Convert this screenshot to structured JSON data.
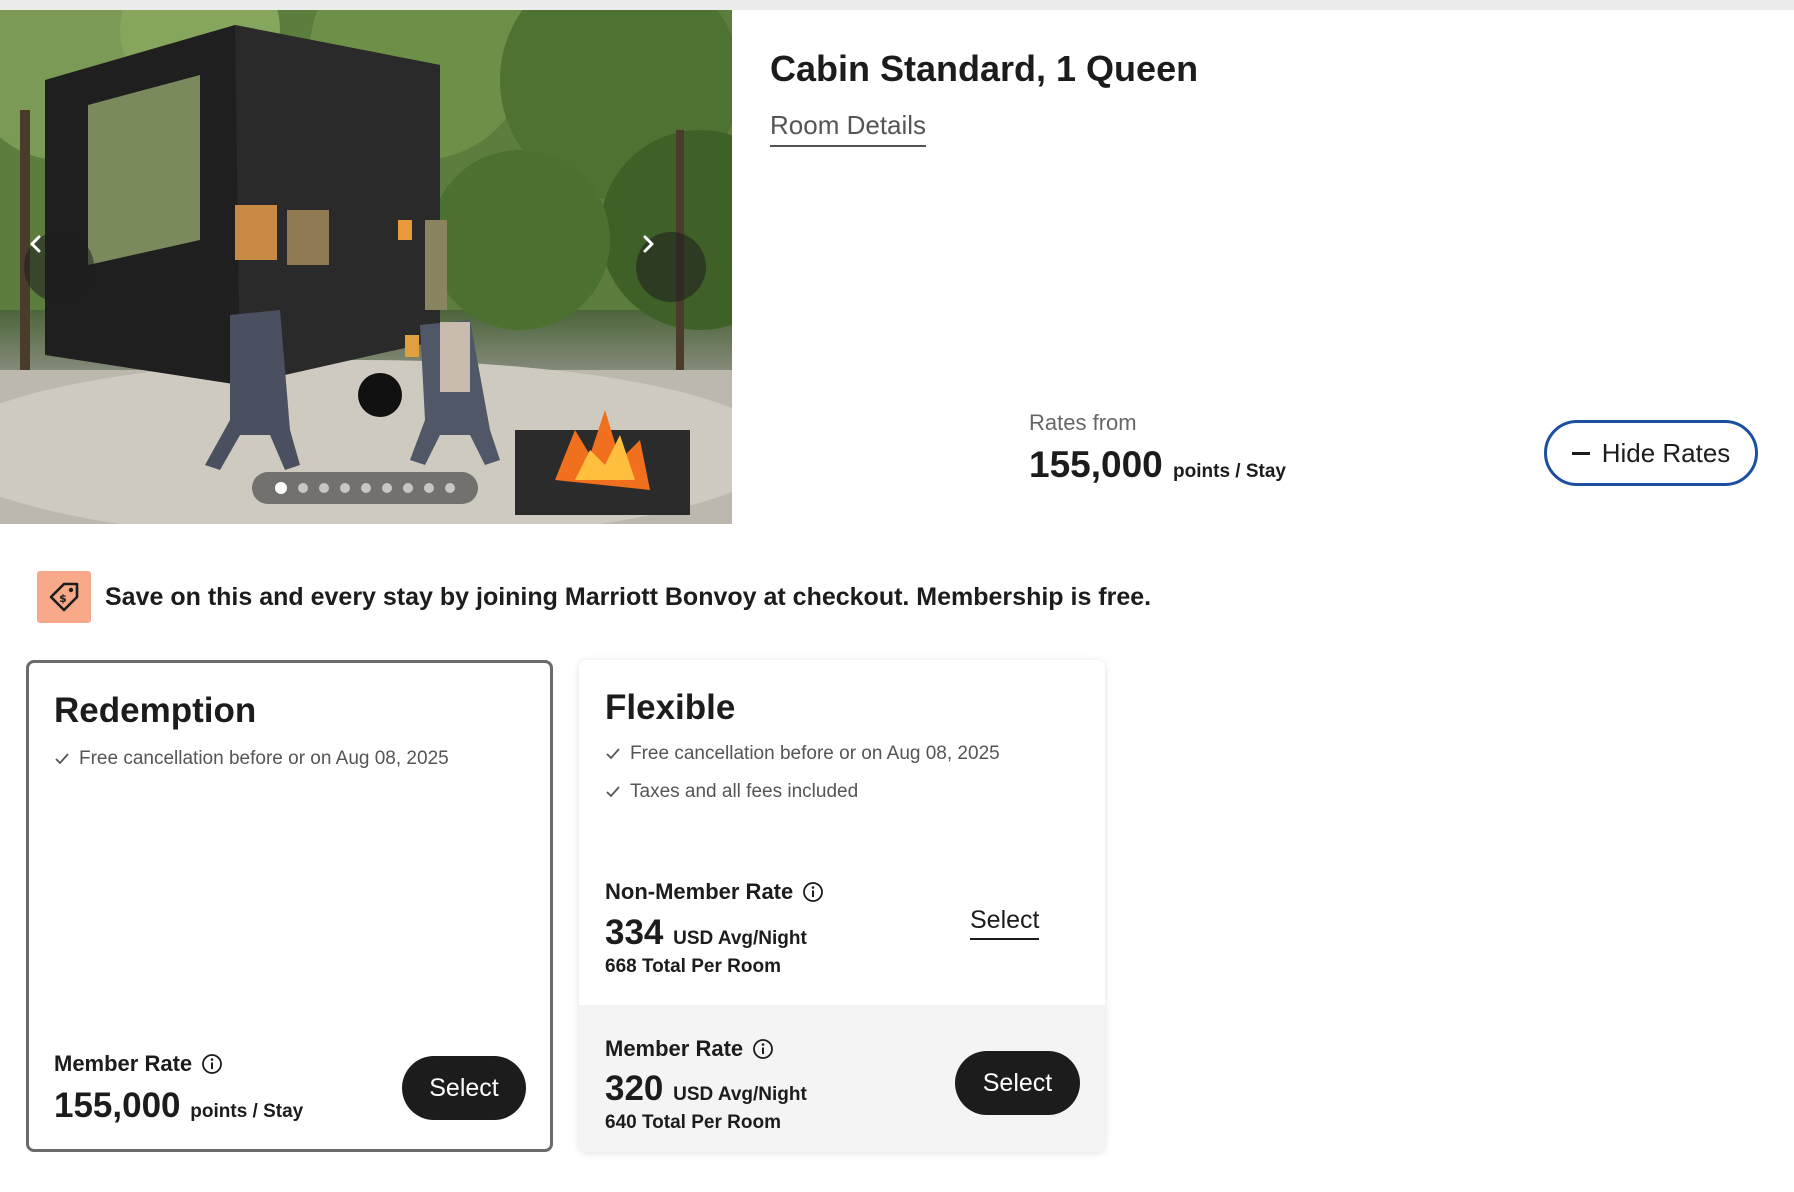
{
  "room": {
    "title": "Cabin Standard, 1 Queen",
    "details_link": "Room Details"
  },
  "gallery": {
    "image_description": "Black tiny cabin in the woods with Adirondack chairs and a fire pit",
    "prev_icon": "chevron-left-icon",
    "next_icon": "chevron-right-icon",
    "slide_count": 9,
    "active_slide": 1
  },
  "rates_summary": {
    "label": "Rates from",
    "amount": "155,000",
    "unit": "points / Stay"
  },
  "hide_rates_button": {
    "label": "Hide Rates",
    "icon": "minus-icon"
  },
  "promo": {
    "icon": "tag-icon",
    "text": "Save on this and every stay by joining Marriott Bonvoy at checkout. Membership is free.",
    "icon_bg": "#f7a98a"
  },
  "cards": {
    "redemption": {
      "title": "Redemption",
      "features": [
        "Free cancellation before or on Aug 08, 2025"
      ],
      "member_rate": {
        "label": "Member Rate",
        "amount": "155,000",
        "unit": "points / Stay",
        "button": "Select"
      }
    },
    "flexible": {
      "title": "Flexible",
      "features": [
        "Free cancellation before or on Aug 08, 2025",
        "Taxes and all fees included"
      ],
      "non_member_rate": {
        "label": "Non-Member Rate",
        "amount": "334",
        "unit": "USD Avg/Night",
        "total": "668 Total Per Room",
        "button": "Select"
      },
      "member_rate": {
        "label": "Member Rate",
        "amount": "320",
        "unit": "USD Avg/Night",
        "total": "640 Total Per Room",
        "button": "Select"
      }
    }
  },
  "colors": {
    "accent_border": "#1c4fa0",
    "dark_button": "#1c1c1c",
    "card_border": "#6b6b6b"
  }
}
